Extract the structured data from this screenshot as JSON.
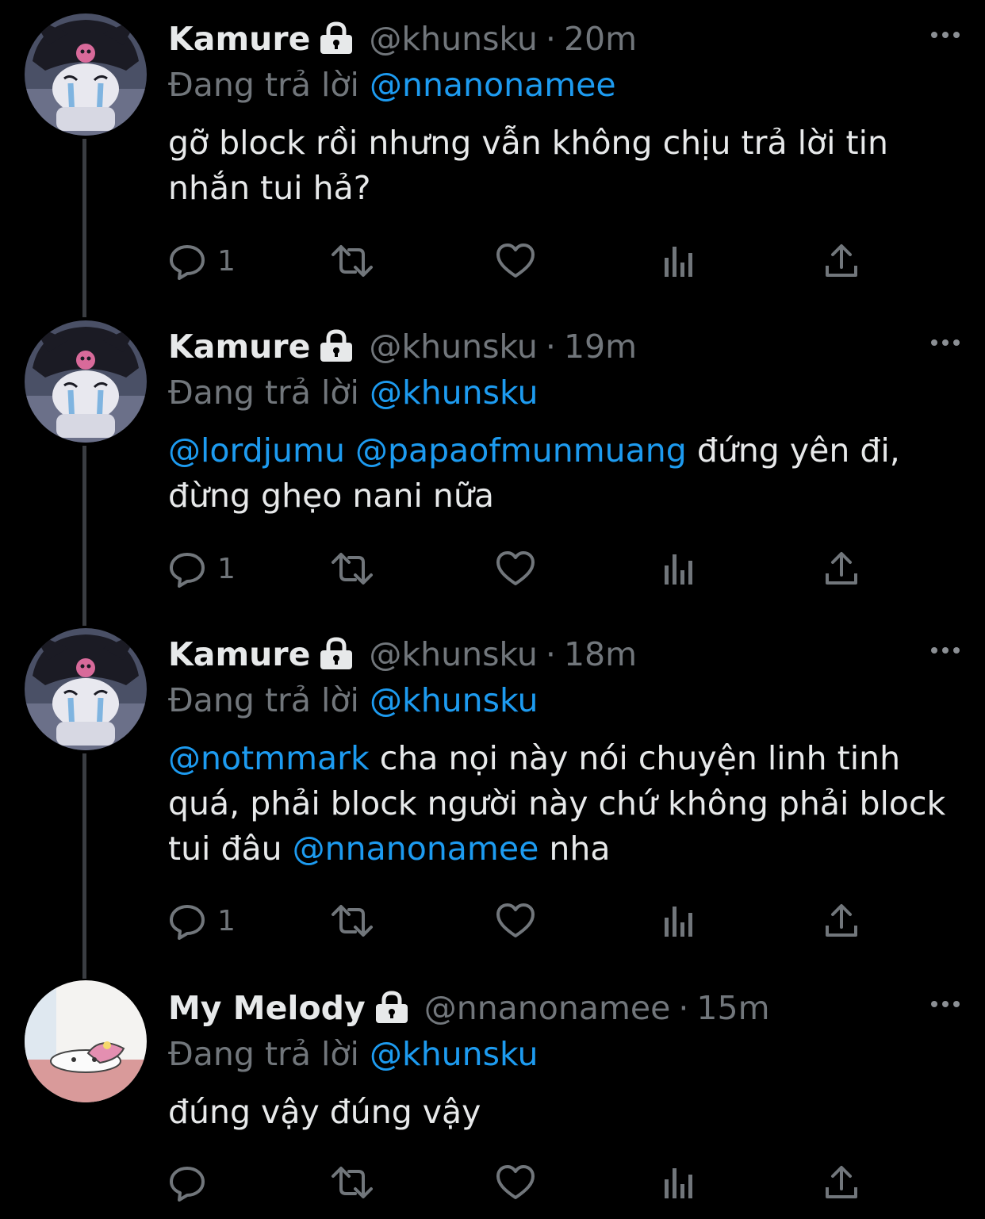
{
  "tweets": [
    {
      "name": "Kamure",
      "handle": "@khunsku",
      "sep": "·",
      "time": "20m",
      "reply_prefix": "Đang trả lời",
      "reply_to": "@nnanonamee",
      "body_segments": [
        {
          "text": "gỡ block rồi nhưng vẫn không chịu trả lời tin nhắn tui hả?",
          "mention": false
        }
      ],
      "reply_count": "1",
      "avatar": "kuromi-crying"
    },
    {
      "name": "Kamure",
      "handle": "@khunsku",
      "sep": "·",
      "time": "19m",
      "reply_prefix": "Đang trả lời",
      "reply_to": "@khunsku",
      "body_segments": [
        {
          "text": "@lordjumu",
          "mention": true
        },
        {
          "text": " ",
          "mention": false
        },
        {
          "text": "@papaofmunmuang",
          "mention": true
        },
        {
          "text": " đứng yên đi, đừng ghẹo nani nữa",
          "mention": false
        }
      ],
      "reply_count": "1",
      "avatar": "kuromi-crying"
    },
    {
      "name": "Kamure",
      "handle": "@khunsku",
      "sep": "·",
      "time": "18m",
      "reply_prefix": "Đang trả lời",
      "reply_to": "@khunsku",
      "body_segments": [
        {
          "text": "@notmmark",
          "mention": true
        },
        {
          "text": " cha nọi này nói chuyện linh tinh quá, phải block người này chứ không phải block tui đâu ",
          "mention": false
        },
        {
          "text": "@nnanonamee",
          "mention": true
        },
        {
          "text": " nha",
          "mention": false
        }
      ],
      "reply_count": "1",
      "avatar": "kuromi-crying"
    },
    {
      "name": "My Melody",
      "handle": "@nnanonamee",
      "sep": "·",
      "time": "15m",
      "reply_prefix": "Đang trả lời",
      "reply_to": "@khunsku",
      "body_segments": [
        {
          "text": "đúng vậy đúng vậy",
          "mention": false
        }
      ],
      "reply_count": "",
      "avatar": "my-melody-lying"
    }
  ],
  "icons": {
    "lock": "lock-icon",
    "more": "more-icon",
    "reply": "reply-icon",
    "retweet": "retweet-icon",
    "like": "like-icon",
    "views": "views-icon",
    "share": "share-icon"
  },
  "colors": {
    "background": "#000000",
    "text": "#e7e9ea",
    "secondary": "#71767b",
    "mention": "#1d9bf0"
  }
}
